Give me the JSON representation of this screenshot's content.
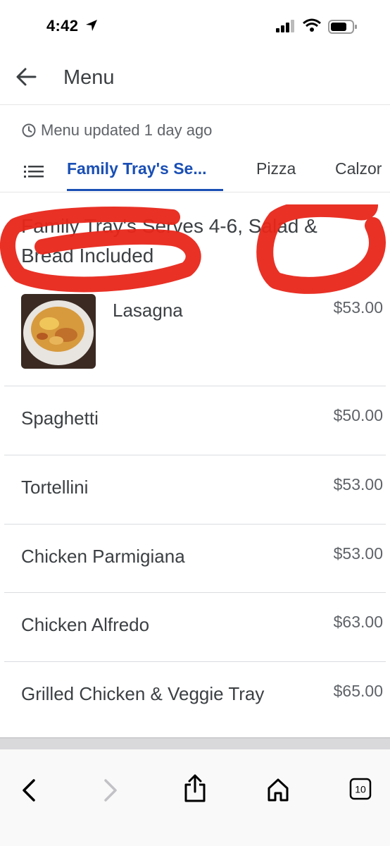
{
  "status": {
    "time": "4:42"
  },
  "header": {
    "title": "Menu"
  },
  "updated": {
    "text": "Menu updated 1 day ago"
  },
  "tabs": [
    {
      "label": "Family Tray's Se..."
    },
    {
      "label": "Pizza"
    },
    {
      "label": "Calzor"
    }
  ],
  "section": {
    "title": "Family Tray's Serves 4-6, Salad & Bread Included"
  },
  "items": [
    {
      "name": "Lasagna",
      "price": "$53.00"
    },
    {
      "name": "Spaghetti",
      "price": "$50.00"
    },
    {
      "name": "Tortellini",
      "price": "$53.00"
    },
    {
      "name": "Chicken Parmigiana",
      "price": "$53.00"
    },
    {
      "name": "Chicken Alfredo",
      "price": "$63.00"
    },
    {
      "name": "Grilled Chicken & Veggie Tray",
      "price": "$65.00"
    }
  ],
  "toolbar": {
    "tabs_count": "10"
  },
  "colors": {
    "accent": "#1a4fb5",
    "scribble": "#e8261a"
  }
}
